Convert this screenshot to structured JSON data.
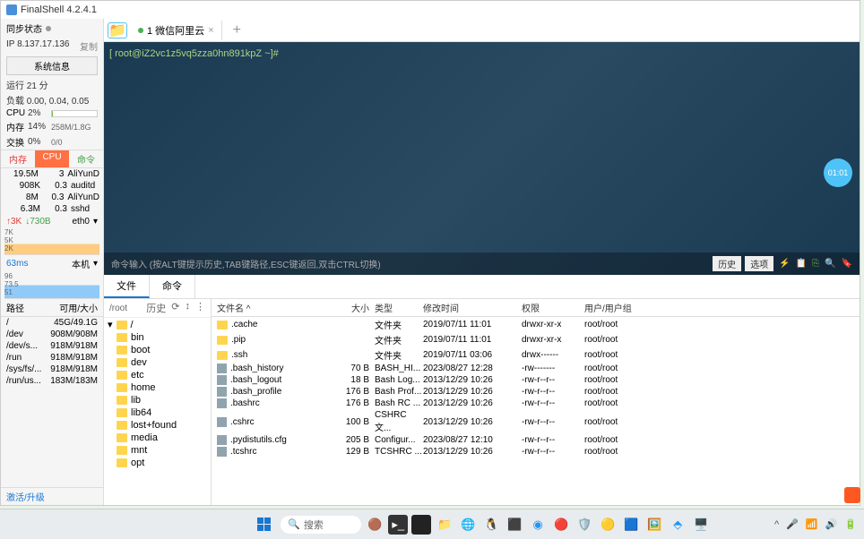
{
  "app": {
    "title": "FinalShell 4.2.4.1"
  },
  "sidebar": {
    "sync_label": "同步状态",
    "ip_label": "IP",
    "ip_value": "8.137.17.136",
    "copy": "复制",
    "sysinfo_btn": "系统信息",
    "uptime": "运行 21 分",
    "load": "负载 0.00, 0.04, 0.05",
    "cpu_label": "CPU",
    "cpu_val": "2%",
    "mem_label": "内存",
    "mem_val": "14%",
    "mem_extra": "258M/1.8G",
    "swap_label": "交换",
    "swap_val": "0%",
    "swap_extra": "0/0",
    "tabs": {
      "mem": "内存",
      "cpu": "CPU",
      "cmd": "命令"
    },
    "procs": [
      {
        "m": "19.5M",
        "c": "3",
        "n": "AliYunD"
      },
      {
        "m": "908K",
        "c": "0.3",
        "n": "auditd"
      },
      {
        "m": "8M",
        "c": "0.3",
        "n": "AliYunD"
      },
      {
        "m": "6.3M",
        "c": "0.3",
        "n": "sshd"
      }
    ],
    "net_up": "3K",
    "net_down": "730B",
    "net_if": "eth0",
    "chart1_labels": [
      "7K",
      "5K",
      "2K"
    ],
    "latency": "63ms",
    "host": "本机",
    "chart2_labels": [
      "96",
      "73.5",
      "51"
    ],
    "disk_h1": "路径",
    "disk_h2": "可用/大小",
    "disks": [
      {
        "p": "/",
        "v": "45G/49.1G"
      },
      {
        "p": "/dev",
        "v": "908M/908M"
      },
      {
        "p": "/dev/s...",
        "v": "918M/918M"
      },
      {
        "p": "/run",
        "v": "918M/918M"
      },
      {
        "p": "/sys/fs/...",
        "v": "918M/918M"
      },
      {
        "p": "/run/us...",
        "v": "183M/183M"
      }
    ],
    "activate": "激活/升级"
  },
  "tabs": {
    "session": "1 微信阿里云"
  },
  "terminal": {
    "prompt": "[ root@iZ2vc1z5vq5zza0hn891kpZ ~]#",
    "badge": "01:01",
    "input_hint": "命令输入 (按ALT键提示历史,TAB键路径,ESC键返回,双击CTRL切换)",
    "history_btn": "历史",
    "option_btn": "选项"
  },
  "bottom_tabs": {
    "files": "文件",
    "cmds": "命令"
  },
  "file_tree": {
    "path": "/root",
    "hist": "历史",
    "root": "/",
    "items": [
      "bin",
      "boot",
      "dev",
      "etc",
      "home",
      "lib",
      "lib64",
      "lost+found",
      "media",
      "mnt",
      "opt"
    ]
  },
  "file_list": {
    "headers": {
      "name": "文件名 ^",
      "size": "大小",
      "type": "类型",
      "date": "修改时间",
      "perm": "权限",
      "owner": "用户/用户组"
    },
    "rows": [
      {
        "n": ".cache",
        "s": "",
        "t": "文件夹",
        "d": "2019/07/11 11:01",
        "p": "drwxr-xr-x",
        "o": "root/root",
        "folder": true
      },
      {
        "n": ".pip",
        "s": "",
        "t": "文件夹",
        "d": "2019/07/11 11:01",
        "p": "drwxr-xr-x",
        "o": "root/root",
        "folder": true
      },
      {
        "n": ".ssh",
        "s": "",
        "t": "文件夹",
        "d": "2019/07/11 03:06",
        "p": "drwx------",
        "o": "root/root",
        "folder": true
      },
      {
        "n": ".bash_history",
        "s": "70 B",
        "t": "BASH_HI...",
        "d": "2023/08/27 12:28",
        "p": "-rw-------",
        "o": "root/root"
      },
      {
        "n": ".bash_logout",
        "s": "18 B",
        "t": "Bash Log...",
        "d": "2013/12/29 10:26",
        "p": "-rw-r--r--",
        "o": "root/root"
      },
      {
        "n": ".bash_profile",
        "s": "176 B",
        "t": "Bash Prof...",
        "d": "2013/12/29 10:26",
        "p": "-rw-r--r--",
        "o": "root/root"
      },
      {
        "n": ".bashrc",
        "s": "176 B",
        "t": "Bash RC ...",
        "d": "2013/12/29 10:26",
        "p": "-rw-r--r--",
        "o": "root/root"
      },
      {
        "n": ".cshrc",
        "s": "100 B",
        "t": "CSHRC 文...",
        "d": "2013/12/29 10:26",
        "p": "-rw-r--r--",
        "o": "root/root"
      },
      {
        "n": ".pydistutils.cfg",
        "s": "205 B",
        "t": "Configur...",
        "d": "2023/08/27 12:10",
        "p": "-rw-r--r--",
        "o": "root/root"
      },
      {
        "n": ".tcshrc",
        "s": "129 B",
        "t": "TCSHRC ...",
        "d": "2013/12/29 10:26",
        "p": "-rw-r--r--",
        "o": "root/root"
      }
    ]
  },
  "taskbar": {
    "search_placeholder": "搜索"
  }
}
